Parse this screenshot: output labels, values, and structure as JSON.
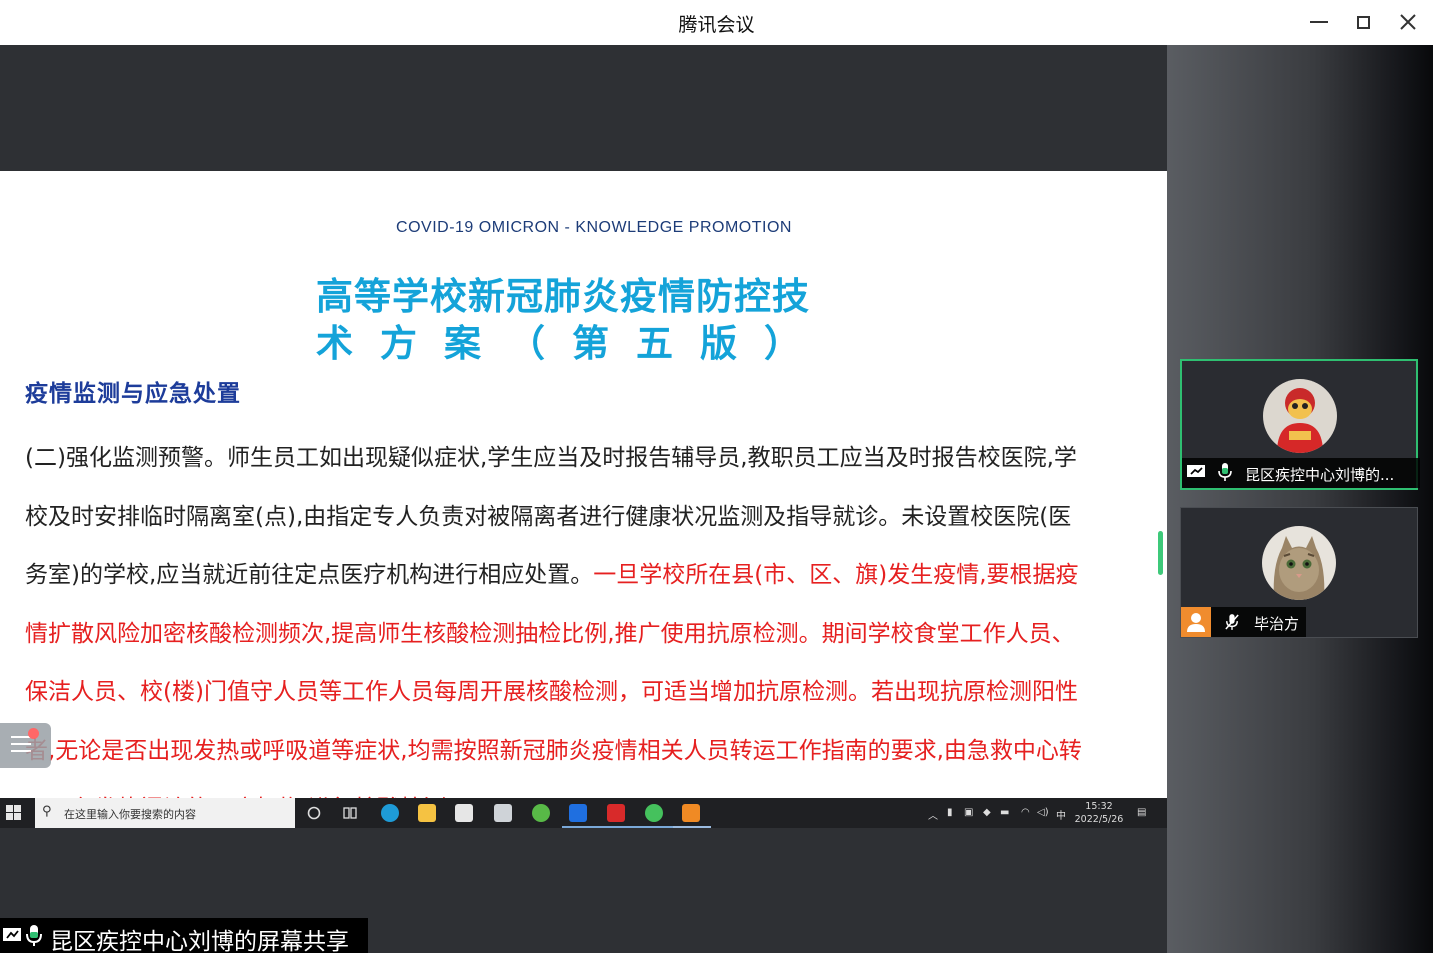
{
  "window": {
    "title": "腾讯会议"
  },
  "slide": {
    "subtitle_en": "COVID-19 OMICRON - KNOWLEDGE PROMOTION",
    "title_line1": "高等学校新冠肺炎疫情防控技",
    "title_line2": "术方案（第五版）",
    "section_heading": "疫情监测与应急处置",
    "body_black_1": "(二)强化监测预警。师生员工如出现疑似症状,学生应当及时报告辅导员,教职员工应当及时报告校医院,学校及时安排临时隔离室(点),由指定专人负责对被隔离者进行健康状况监测及指导就诊。未设置校医院(医务室)的学校,应当就近前往定点医疗机构进行相应处置。",
    "body_red": "一旦学校所在县(市、区、旗)发生疫情,要根据疫情扩散风险加密核酸检测频次,提高师生核酸检测抽检比例,推广使用抗原检测。期间学校食堂工作人员、保洁人员、校(楼)门值守人员等工作人员每周开展核酸检测，可适当增加抗原检测。若出现抗原检测阳性者,无论是否出现发热或呼吸道等症状,均需按照新冠肺炎疫情相关人员转运工作指南的要求,由急救中心转运至有发热门诊的医疗机构,进行核酸检测。"
  },
  "taskbar": {
    "search_placeholder": "在这里输入你要搜索的内容",
    "ime": "中",
    "time": "15:32",
    "date": "2022/5/26"
  },
  "share_label": "昆区疾控中心刘博的屏幕共享",
  "participants": [
    {
      "name": "昆区疾控中心刘博的...",
      "active": true
    },
    {
      "name": "毕治方",
      "active": false
    }
  ],
  "colors": {
    "accent_green": "#2fbf71",
    "slide_title_blue": "#14a3d9",
    "section_blue": "#1d3c9a",
    "body_red": "#e62020"
  }
}
